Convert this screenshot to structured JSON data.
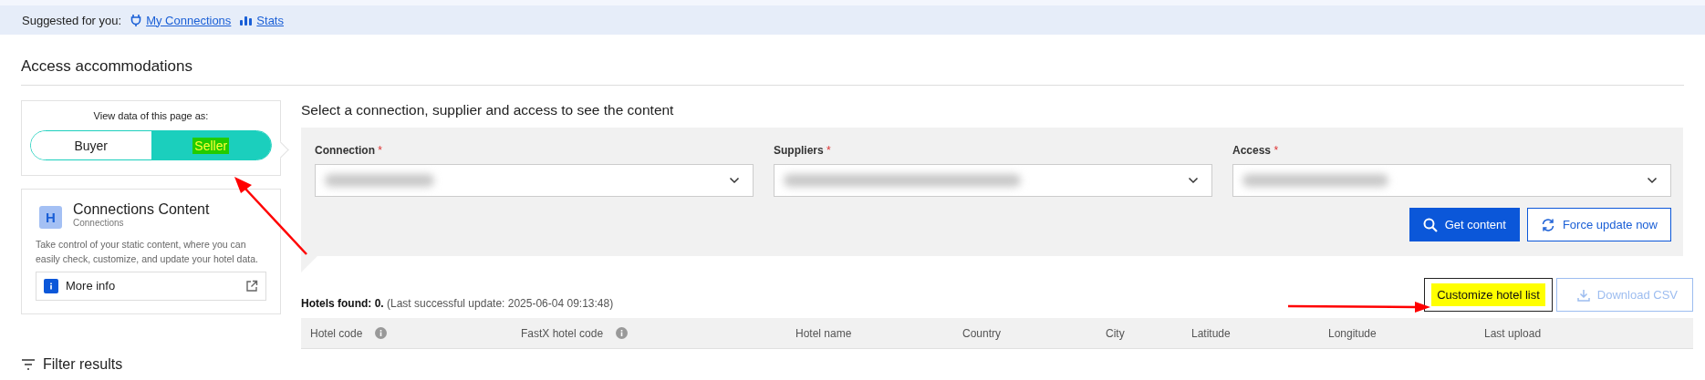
{
  "suggestions": {
    "label": "Suggested for you:",
    "links": [
      {
        "kind": "plug",
        "text": "My Connections"
      },
      {
        "kind": "chart",
        "text": "Stats"
      }
    ]
  },
  "page_title": "Access accommodations",
  "view_toggle": {
    "label": "View data of this page as:",
    "options": [
      {
        "label": "Buyer",
        "selected": false,
        "highlighted": false
      },
      {
        "label": "Seller",
        "selected": true,
        "highlighted": true
      }
    ]
  },
  "product_card": {
    "badge": "H",
    "title": "Connections Content",
    "subtitle": "Connections",
    "description": "Take control of your static content, where you can easily check, customize, and update your hotel data.",
    "link": "More info"
  },
  "filter_title": "Filter results",
  "selector": {
    "heading": "Select a connection, supplier and access to see the content",
    "fields": [
      {
        "label": "Connection",
        "required_mark": "*"
      },
      {
        "label": "Suppliers",
        "required_mark": "*"
      },
      {
        "label": "Access",
        "required_mark": "*"
      }
    ],
    "buttons": [
      {
        "kind": "search",
        "label": "Get content"
      },
      {
        "kind": "refresh",
        "label": "Force update now"
      }
    ]
  },
  "results": {
    "summary": "**Hotels found: 0.** (Last successful update: 2025-06-04 09:13:48)",
    "buttons": [
      {
        "kind": "customize",
        "label": "Customize hotel list",
        "highlighted": true,
        "disabled": false
      },
      {
        "kind": "download",
        "label": "Download CSV",
        "highlighted": false,
        "disabled": true
      }
    ],
    "columns": [
      {
        "label": "Hotel code",
        "info": true
      },
      {
        "label": "FastX hotel code",
        "info": true
      },
      {
        "label": "Hotel name",
        "info": false
      },
      {
        "label": "Country",
        "info": false
      },
      {
        "label": "City",
        "info": false
      },
      {
        "label": "Latitude",
        "info": false
      },
      {
        "label": "Longitude",
        "info": false
      },
      {
        "label": "Last upload",
        "info": false
      }
    ]
  }
}
